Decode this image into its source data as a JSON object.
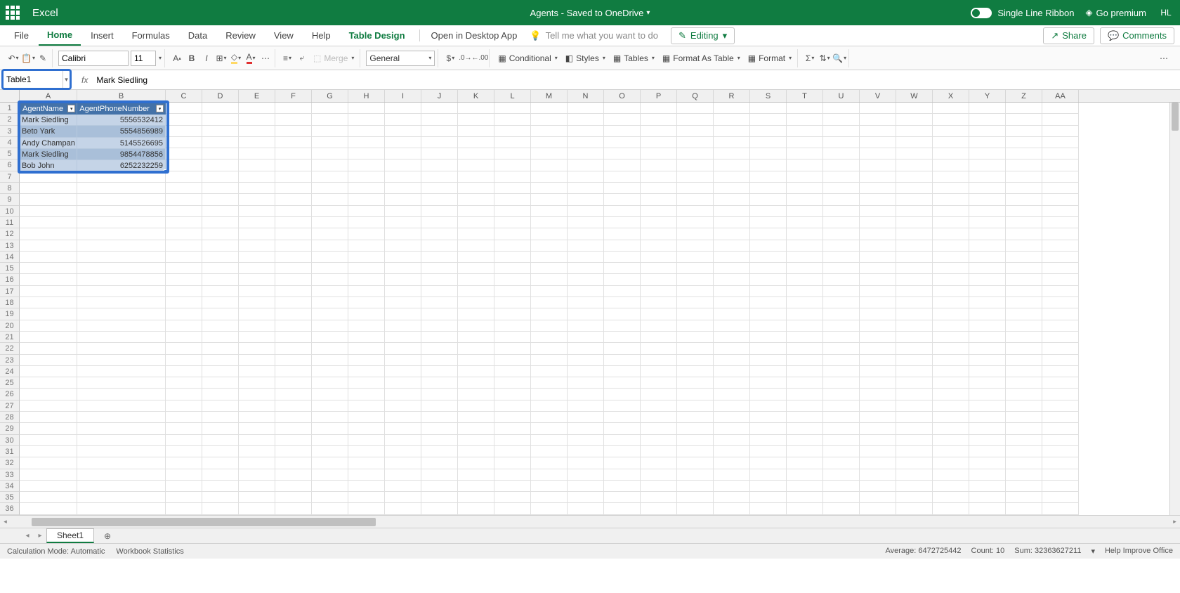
{
  "app": {
    "name": "Excel",
    "document": "Agents - Saved to OneDrive",
    "user_initials": "HL"
  },
  "header_right": {
    "ribbon_mode": "Single Line Ribbon",
    "premium": "Go premium"
  },
  "tabs": {
    "file": "File",
    "home": "Home",
    "insert": "Insert",
    "formulas": "Formulas",
    "data": "Data",
    "review": "Review",
    "view": "View",
    "help": "Help",
    "table_design": "Table Design",
    "open_desktop": "Open in Desktop App",
    "tellme": "Tell me what you want to do",
    "editing": "Editing",
    "share": "Share",
    "comments": "Comments"
  },
  "toolbar": {
    "font_name": "Calibri",
    "font_size": "11",
    "merge": "Merge",
    "number_format": "General",
    "conditional": "Conditional",
    "styles": "Styles",
    "tables": "Tables",
    "format_as_table": "Format As Table",
    "format": "Format"
  },
  "namebox": "Table1",
  "formula": "Mark Siedling",
  "columns": [
    "A",
    "B",
    "C",
    "D",
    "E",
    "F",
    "G",
    "H",
    "I",
    "J",
    "K",
    "L",
    "M",
    "N",
    "O",
    "P",
    "Q",
    "R",
    "S",
    "T",
    "U",
    "V",
    "W",
    "X",
    "Y",
    "Z",
    "AA"
  ],
  "col_widths": {
    "A": 82,
    "B": 126,
    "default": 52
  },
  "rows_shown": 36,
  "table": {
    "headers": [
      "AgentName",
      "AgentPhoneNumber"
    ],
    "rows": [
      [
        "Mark Siedling",
        "5556532412"
      ],
      [
        "Beto Yark",
        "5554856989"
      ],
      [
        "Andy Champan",
        "5145526695"
      ],
      [
        "Mark Siedling",
        "9854478856"
      ],
      [
        "Bob John",
        "6252232259"
      ]
    ]
  },
  "sheet": {
    "active": "Sheet1"
  },
  "status": {
    "calc": "Calculation Mode: Automatic",
    "wb_stats": "Workbook Statistics",
    "avg": "Average: 6472725442",
    "count": "Count: 10",
    "sum": "Sum: 32363627211",
    "help": "Help Improve Office"
  }
}
